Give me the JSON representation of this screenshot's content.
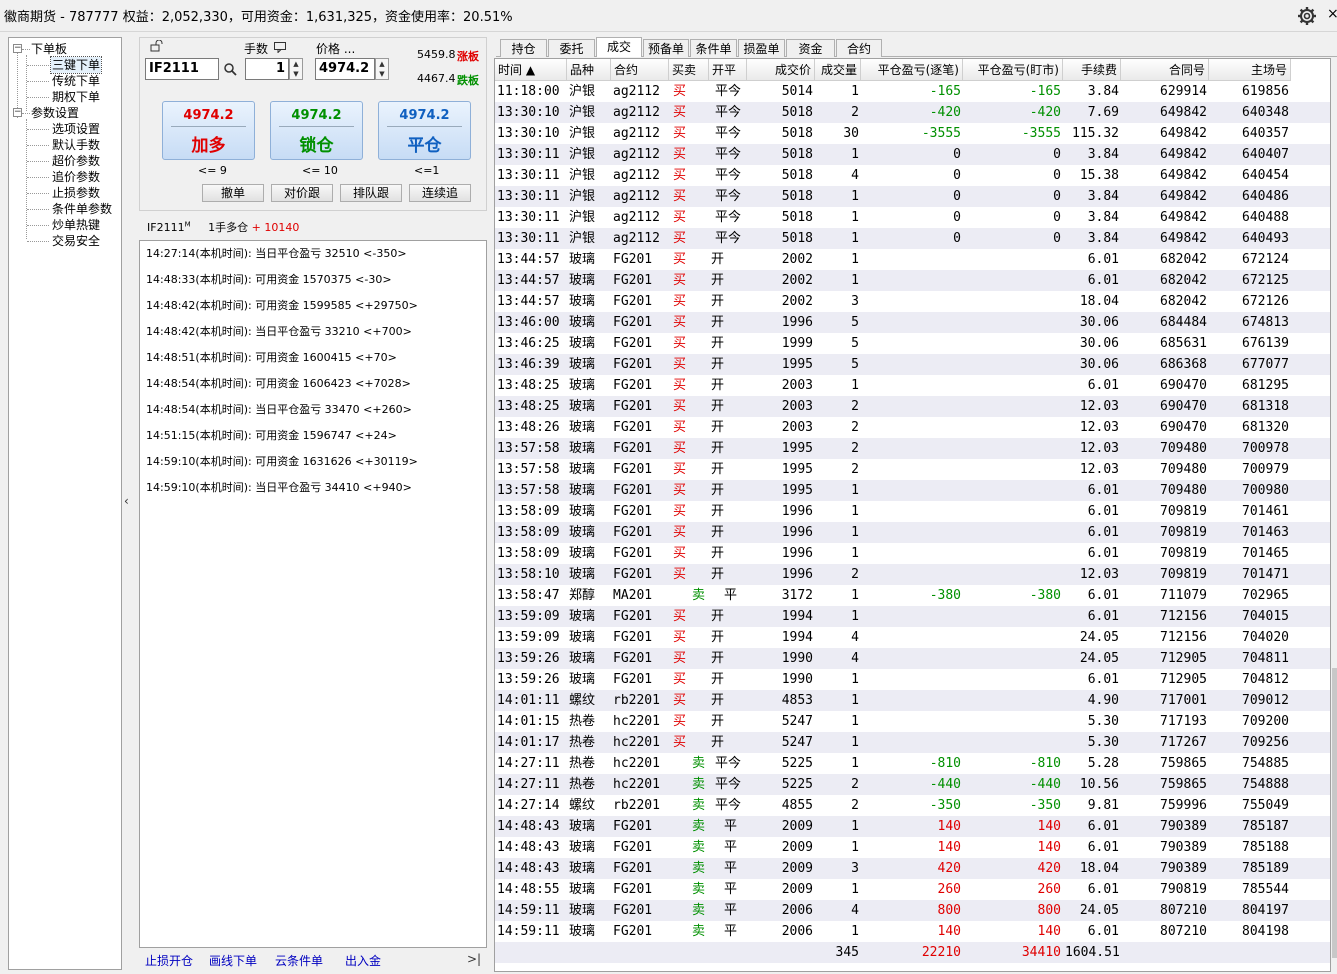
{
  "title": {
    "text": "徽商期货 - 787777  权益：2,052,330，可用资金：1,631,325，资金使用率：20.51%",
    "close": "×"
  },
  "tree": [
    {
      "label": "下单板",
      "level": 0,
      "box": "-"
    },
    {
      "label": "三键下单",
      "level": 1,
      "selected": true
    },
    {
      "label": "传统下单",
      "level": 1
    },
    {
      "label": "期权下单",
      "level": 1
    },
    {
      "label": "参数设置",
      "level": 0,
      "box": "-"
    },
    {
      "label": "选项设置",
      "level": 1
    },
    {
      "label": "默认手数",
      "level": 1
    },
    {
      "label": "超价参数",
      "level": 1
    },
    {
      "label": "追价参数",
      "level": 1
    },
    {
      "label": "止损参数",
      "level": 1
    },
    {
      "label": "条件单参数",
      "level": 1
    },
    {
      "label": "炒单热键",
      "level": 1
    },
    {
      "label": "交易安全",
      "level": 1
    }
  ],
  "collapse_arrow": "‹",
  "order": {
    "qty_label": "手数",
    "price_label": "价格 ...",
    "contract": "IF2111",
    "qty": "1",
    "price": "4974.2",
    "limit_up_price": "5459.8",
    "limit_up_tag": "涨板",
    "limit_down_price": "4467.4",
    "limit_down_tag": "跌板",
    "colors": {
      "up": "#e00000",
      "down": "#009000"
    },
    "buttons": [
      {
        "price": "4974.2",
        "label": "加多",
        "limit": "<= 9",
        "price_color": "#e00000",
        "label_color": "#e00000"
      },
      {
        "price": "4974.2",
        "label": "锁仓",
        "limit": "<= 10",
        "price_color": "#009000",
        "label_color": "#009000"
      },
      {
        "price": "4974.2",
        "label": "平仓",
        "limit": "<=1",
        "price_color": "#1060c0",
        "label_color": "#1060c0"
      }
    ],
    "actions": [
      "撤单",
      "对价跟",
      "排队跟",
      "连续追"
    ]
  },
  "position": {
    "contract": "IF2111",
    "sup": "M",
    "text": "1手多仓",
    "pnl": "+ 10140"
  },
  "log": [
    "14:27:14(本机时间): 当日平仓盈亏 32510  <-350>",
    "14:48:33(本机时间): 可用资金 1570375  <-30>",
    "14:48:42(本机时间): 可用资金 1599585  <+29750>",
    "14:48:42(本机时间): 当日平仓盈亏 33210  <+700>",
    "14:48:51(本机时间): 可用资金 1600415  <+70>",
    "14:48:54(本机时间): 可用资金 1606423  <+7028>",
    "14:48:54(本机时间): 当日平仓盈亏 33470  <+260>",
    "14:51:15(本机时间): 可用资金 1596747  <+24>",
    "14:59:10(本机时间): 可用资金 1631626  <+30119>",
    "14:59:10(本机时间): 当日平仓盈亏 34410  <+940>"
  ],
  "footer_links": [
    "止损开仓",
    "画线下单",
    "云条件单",
    "出入金",
    ">|"
  ],
  "tabs": [
    "持仓",
    "委托",
    "成交",
    "预备单",
    "条件单",
    "损盈单",
    "资金",
    "合约"
  ],
  "active_tab": 2,
  "columns": [
    "时间 ▲",
    "品种",
    "合约",
    "买卖",
    "开平",
    "成交价",
    "成交量",
    "平仓盈亏(逐笔)",
    "平仓盈亏(盯市)",
    "手续费",
    "合同号",
    "主场号"
  ],
  "rows": [
    [
      "11:18:00",
      "沪银",
      "ag2112",
      "买",
      "平今",
      "5014",
      "1",
      "-165",
      "-165",
      "3.84",
      "629914",
      "619856"
    ],
    [
      "13:30:10",
      "沪银",
      "ag2112",
      "买",
      "平今",
      "5018",
      "2",
      "-420",
      "-420",
      "7.69",
      "649842",
      "640348"
    ],
    [
      "13:30:10",
      "沪银",
      "ag2112",
      "买",
      "平今",
      "5018",
      "30",
      "-3555",
      "-3555",
      "115.32",
      "649842",
      "640357"
    ],
    [
      "13:30:11",
      "沪银",
      "ag2112",
      "买",
      "平今",
      "5018",
      "1",
      "0",
      "0",
      "3.84",
      "649842",
      "640407"
    ],
    [
      "13:30:11",
      "沪银",
      "ag2112",
      "买",
      "平今",
      "5018",
      "4",
      "0",
      "0",
      "15.38",
      "649842",
      "640454"
    ],
    [
      "13:30:11",
      "沪银",
      "ag2112",
      "买",
      "平今",
      "5018",
      "1",
      "0",
      "0",
      "3.84",
      "649842",
      "640486"
    ],
    [
      "13:30:11",
      "沪银",
      "ag2112",
      "买",
      "平今",
      "5018",
      "1",
      "0",
      "0",
      "3.84",
      "649842",
      "640488"
    ],
    [
      "13:30:11",
      "沪银",
      "ag2112",
      "买",
      "平今",
      "5018",
      "1",
      "0",
      "0",
      "3.84",
      "649842",
      "640493"
    ],
    [
      "13:44:57",
      "玻璃",
      "FG201",
      "买",
      "开",
      "2002",
      "1",
      "",
      "",
      "6.01",
      "682042",
      "672124"
    ],
    [
      "13:44:57",
      "玻璃",
      "FG201",
      "买",
      "开",
      "2002",
      "1",
      "",
      "",
      "6.01",
      "682042",
      "672125"
    ],
    [
      "13:44:57",
      "玻璃",
      "FG201",
      "买",
      "开",
      "2002",
      "3",
      "",
      "",
      "18.04",
      "682042",
      "672126"
    ],
    [
      "13:46:00",
      "玻璃",
      "FG201",
      "买",
      "开",
      "1996",
      "5",
      "",
      "",
      "30.06",
      "684484",
      "674813"
    ],
    [
      "13:46:25",
      "玻璃",
      "FG201",
      "买",
      "开",
      "1999",
      "5",
      "",
      "",
      "30.06",
      "685631",
      "676139"
    ],
    [
      "13:46:39",
      "玻璃",
      "FG201",
      "买",
      "开",
      "1995",
      "5",
      "",
      "",
      "30.06",
      "686368",
      "677077"
    ],
    [
      "13:48:25",
      "玻璃",
      "FG201",
      "买",
      "开",
      "2003",
      "1",
      "",
      "",
      "6.01",
      "690470",
      "681295"
    ],
    [
      "13:48:25",
      "玻璃",
      "FG201",
      "买",
      "开",
      "2003",
      "2",
      "",
      "",
      "12.03",
      "690470",
      "681318"
    ],
    [
      "13:48:26",
      "玻璃",
      "FG201",
      "买",
      "开",
      "2003",
      "2",
      "",
      "",
      "12.03",
      "690470",
      "681320"
    ],
    [
      "13:57:58",
      "玻璃",
      "FG201",
      "买",
      "开",
      "1995",
      "2",
      "",
      "",
      "12.03",
      "709480",
      "700978"
    ],
    [
      "13:57:58",
      "玻璃",
      "FG201",
      "买",
      "开",
      "1995",
      "2",
      "",
      "",
      "12.03",
      "709480",
      "700979"
    ],
    [
      "13:57:58",
      "玻璃",
      "FG201",
      "买",
      "开",
      "1995",
      "1",
      "",
      "",
      "6.01",
      "709480",
      "700980"
    ],
    [
      "13:58:09",
      "玻璃",
      "FG201",
      "买",
      "开",
      "1996",
      "1",
      "",
      "",
      "6.01",
      "709819",
      "701461"
    ],
    [
      "13:58:09",
      "玻璃",
      "FG201",
      "买",
      "开",
      "1996",
      "1",
      "",
      "",
      "6.01",
      "709819",
      "701463"
    ],
    [
      "13:58:09",
      "玻璃",
      "FG201",
      "买",
      "开",
      "1996",
      "1",
      "",
      "",
      "6.01",
      "709819",
      "701465"
    ],
    [
      "13:58:10",
      "玻璃",
      "FG201",
      "买",
      "开",
      "1996",
      "2",
      "",
      "",
      "12.03",
      "709819",
      "701471"
    ],
    [
      "13:58:47",
      "郑醇",
      "MA201",
      "卖",
      "平",
      "3172",
      "1",
      "-380",
      "-380",
      "6.01",
      "711079",
      "702965"
    ],
    [
      "13:59:09",
      "玻璃",
      "FG201",
      "买",
      "开",
      "1994",
      "1",
      "",
      "",
      "6.01",
      "712156",
      "704015"
    ],
    [
      "13:59:09",
      "玻璃",
      "FG201",
      "买",
      "开",
      "1994",
      "4",
      "",
      "",
      "24.05",
      "712156",
      "704020"
    ],
    [
      "13:59:26",
      "玻璃",
      "FG201",
      "买",
      "开",
      "1990",
      "4",
      "",
      "",
      "24.05",
      "712905",
      "704811"
    ],
    [
      "13:59:26",
      "玻璃",
      "FG201",
      "买",
      "开",
      "1990",
      "1",
      "",
      "",
      "6.01",
      "712905",
      "704812"
    ],
    [
      "14:01:11",
      "螺纹",
      "rb2201",
      "买",
      "开",
      "4853",
      "1",
      "",
      "",
      "4.90",
      "717001",
      "709012"
    ],
    [
      "14:01:15",
      "热卷",
      "hc2201",
      "买",
      "开",
      "5247",
      "1",
      "",
      "",
      "5.30",
      "717193",
      "709200"
    ],
    [
      "14:01:17",
      "热卷",
      "hc2201",
      "买",
      "开",
      "5247",
      "1",
      "",
      "",
      "5.30",
      "717267",
      "709256"
    ],
    [
      "14:27:11",
      "热卷",
      "hc2201",
      "卖",
      "平今",
      "5225",
      "1",
      "-810",
      "-810",
      "5.28",
      "759865",
      "754885"
    ],
    [
      "14:27:11",
      "热卷",
      "hc2201",
      "卖",
      "平今",
      "5225",
      "2",
      "-440",
      "-440",
      "10.56",
      "759865",
      "754888"
    ],
    [
      "14:27:14",
      "螺纹",
      "rb2201",
      "卖",
      "平今",
      "4855",
      "2",
      "-350",
      "-350",
      "9.81",
      "759996",
      "755049"
    ],
    [
      "14:48:43",
      "玻璃",
      "FG201",
      "卖",
      "平",
      "2009",
      "1",
      "140",
      "140",
      "6.01",
      "790389",
      "785187"
    ],
    [
      "14:48:43",
      "玻璃",
      "FG201",
      "卖",
      "平",
      "2009",
      "1",
      "140",
      "140",
      "6.01",
      "790389",
      "785188"
    ],
    [
      "14:48:43",
      "玻璃",
      "FG201",
      "卖",
      "平",
      "2009",
      "3",
      "420",
      "420",
      "18.04",
      "790389",
      "785189"
    ],
    [
      "14:48:55",
      "玻璃",
      "FG201",
      "卖",
      "平",
      "2009",
      "1",
      "260",
      "260",
      "6.01",
      "790819",
      "785544"
    ],
    [
      "14:59:11",
      "玻璃",
      "FG201",
      "卖",
      "平",
      "2006",
      "4",
      "800",
      "800",
      "24.05",
      "807210",
      "804197"
    ],
    [
      "14:59:11",
      "玻璃",
      "FG201",
      "卖",
      "平",
      "2006",
      "1",
      "140",
      "140",
      "6.01",
      "807210",
      "804198"
    ]
  ],
  "totals": {
    "qty": "345",
    "pnl_trade": "22210",
    "pnl_mark": "34410",
    "fee": "1604.51"
  },
  "colors": {
    "buy": "#e00000",
    "sell": "#009000",
    "row_alt": "#ececf4",
    "row": "#ffffff"
  }
}
